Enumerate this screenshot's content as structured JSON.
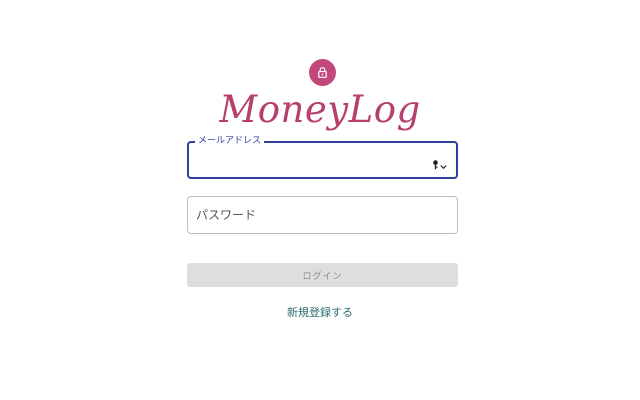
{
  "header": {
    "lock_icon": "lock-icon",
    "app_title": "MoneyLog"
  },
  "form": {
    "email": {
      "label": "メールアドレス",
      "value": "",
      "autofill_icon": "key-icon"
    },
    "password": {
      "placeholder": "パスワード",
      "value": ""
    },
    "login_label": "ログイン",
    "signup_label": "新規登録する"
  },
  "colors": {
    "brand": "#b63f6d",
    "focus": "#2f3f9e",
    "link": "#2e6e6e",
    "disabled_bg": "#dedede"
  }
}
